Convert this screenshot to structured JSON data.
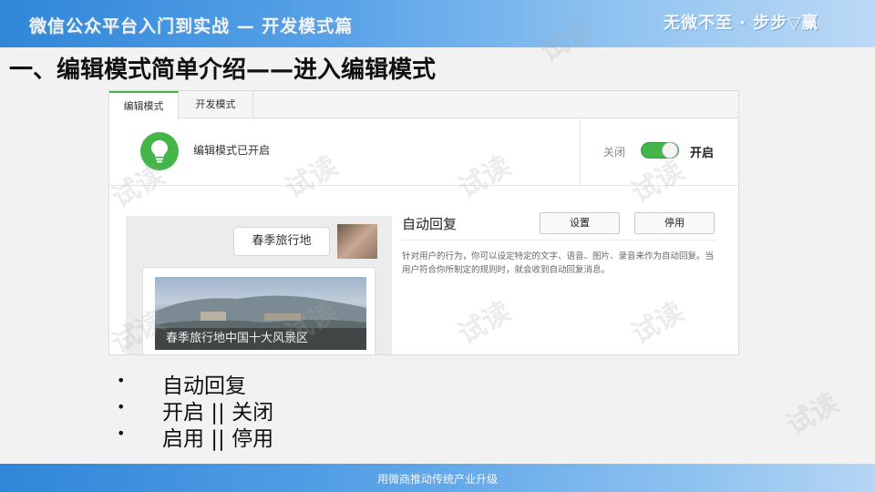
{
  "banner": {
    "left_title": "微信公众平台入门到实战 — 开发模式篇",
    "right_slogan": "无微不至 · 步步▽赢"
  },
  "slide": {
    "title": "一、编辑模式简单介绍——进入编辑模式"
  },
  "ui": {
    "tabs": [
      {
        "label": "编辑模式",
        "active": true
      },
      {
        "label": "开发模式",
        "active": false
      }
    ],
    "status": {
      "text": "编辑模式已开启",
      "off_label": "关闭",
      "on_label": "开启",
      "toggle_on": true,
      "accent_color": "#44b549",
      "icon": "lightbulb-icon"
    },
    "preview": {
      "bubble_text": "春季旅行地",
      "card_caption": "春季旅行地中国十大风景区"
    },
    "auto_reply": {
      "title": "自动回复",
      "setting_button": "设置",
      "disable_button": "停用",
      "description": "针对用户的行为，你可以设定特定的文字、语音、图片、录音来作为自动回复。当用户符合你所制定的规则时，就会收到自动回复消息。"
    }
  },
  "bullets": [
    "自动回复",
    "开启 || 关闭",
    "启用 || 停用"
  ],
  "watermark": "试读",
  "footer": {
    "text": "用微商推动传统产业升级"
  },
  "colors": {
    "banner_blue": "#2f86d8",
    "green": "#44b549"
  }
}
